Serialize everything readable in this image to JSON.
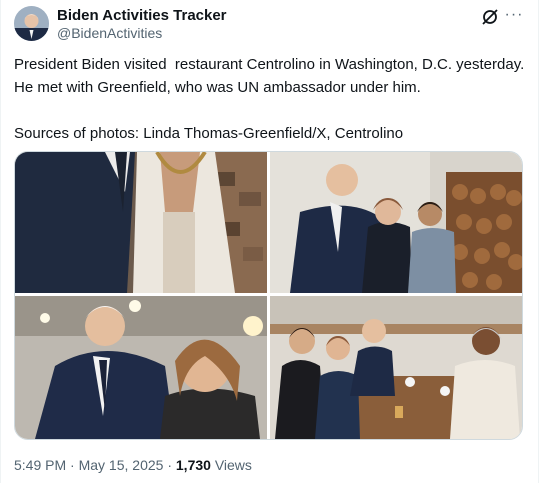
{
  "author": {
    "name": "Biden Activities Tracker",
    "handle": "@BidenActivities",
    "avatar": "avatar-photo"
  },
  "header_icons": {
    "grok": "grok-icon",
    "more": "more-icon",
    "more_glyph": "···"
  },
  "tweet": {
    "text": "President Biden visited  restaurant Centrolino in Washington, D.C. yesterday. He met with Greenfield, who was UN ambassador under him.\n\nSources of photos: Linda Thomas-Greenfield/X, Centrolino"
  },
  "media": {
    "photos": [
      "photo-biden-greenfield-closeup",
      "photo-biden-with-staff",
      "photo-biden-hugging-woman",
      "photo-biden-table-group"
    ]
  },
  "meta": {
    "time": "5:49 PM",
    "sep1": " · ",
    "date": "May 15, 2025",
    "sep2": " · ",
    "views_count": "1,730",
    "views_label": " Views"
  }
}
